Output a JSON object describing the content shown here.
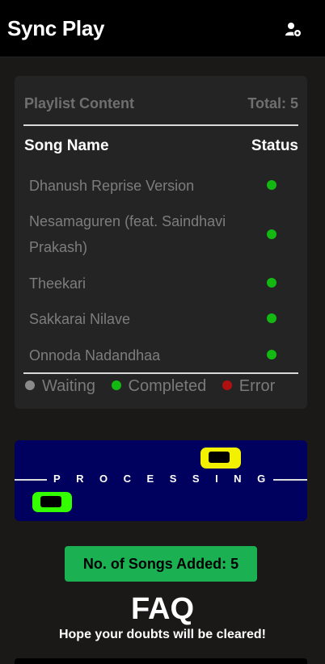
{
  "header": {
    "title": "Sync Play",
    "user_icon": "user-settings-icon"
  },
  "playlist": {
    "heading": "Playlist Content",
    "total_label": "Total: 5",
    "columns": {
      "name": "Song Name",
      "status": "Status"
    },
    "songs": [
      {
        "name": "Dhanush Reprise Version",
        "status": "Completed"
      },
      {
        "name": "Nesamaguren (feat. Saindhavi Prakash)",
        "status": "Completed"
      },
      {
        "name": "Theekari",
        "status": "Completed"
      },
      {
        "name": "Sakkarai Nilave",
        "status": "Completed"
      },
      {
        "name": "Onnoda Nadandhaa",
        "status": "Completed"
      }
    ],
    "legend": [
      {
        "label": "Waiting",
        "color": "#8a8a8a"
      },
      {
        "label": "Completed",
        "color": "#13b813"
      },
      {
        "label": "Error",
        "color": "#b01010"
      }
    ]
  },
  "processing": {
    "text": "PROCESSING",
    "colors": {
      "background": "#00005e",
      "car_yellow": "#f2f200",
      "car_green": "#33ff00"
    }
  },
  "songs_added": "No. of Songs Added: 5",
  "faq": {
    "title": "FAQ",
    "subtitle": "Hope your doubts will be cleared!"
  }
}
